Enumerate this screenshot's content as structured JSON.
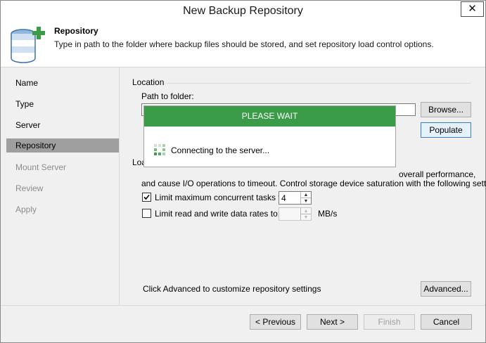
{
  "window": {
    "title": "New Backup Repository",
    "close_glyph": "✕"
  },
  "header": {
    "title": "Repository",
    "description": "Type in path to the folder where backup files should be stored, and set repository load control options.",
    "icon": "database-add-icon"
  },
  "sidebar": {
    "items": [
      {
        "label": "Name",
        "state": "done"
      },
      {
        "label": "Type",
        "state": "done"
      },
      {
        "label": "Server",
        "state": "done"
      },
      {
        "label": "Repository",
        "state": "active"
      },
      {
        "label": "Mount Server",
        "state": "disabled"
      },
      {
        "label": "Review",
        "state": "disabled"
      },
      {
        "label": "Apply",
        "state": "disabled"
      }
    ]
  },
  "location": {
    "group_label": "Location",
    "path_label": "Path to folder:",
    "path_value": "",
    "browse_label": "Browse...",
    "populate_label": "Populate"
  },
  "load_control": {
    "group_label_visible": "Loa",
    "desc_line1_visible": "overall performance,",
    "desc_line2": "and cause I/O operations to timeout. Control storage device saturation with the following settings:",
    "limit_tasks_label": "Limit maximum concurrent tasks to:",
    "limit_tasks_checked": true,
    "limit_tasks_value": "4",
    "limit_rate_label": "Limit read and write data rates to:",
    "limit_rate_checked": false,
    "limit_rate_value": "",
    "rate_unit": "MB/s"
  },
  "advanced": {
    "hint": "Click Advanced to customize repository settings",
    "button_label": "Advanced..."
  },
  "footer": {
    "previous_label": "< Previous",
    "next_label": "Next >",
    "finish_label": "Finish",
    "cancel_label": "Cancel"
  },
  "modal": {
    "title": "PLEASE WAIT",
    "message": "Connecting to the server...",
    "header_color": "#3a9b48"
  },
  "colors": {
    "accent_green": "#3a9b48",
    "nav_active_bg": "#9f9f9f"
  }
}
